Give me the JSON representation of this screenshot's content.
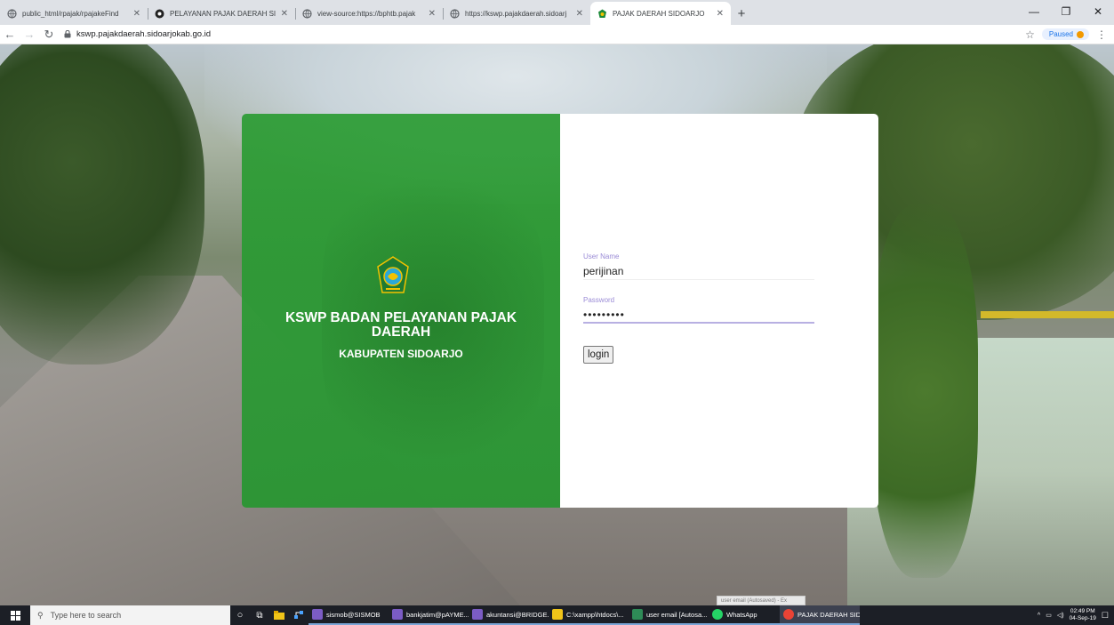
{
  "browser": {
    "tabs": [
      {
        "title": "public_html/rpajak/rpajakeFind",
        "icon": "globe-icon",
        "active": false
      },
      {
        "title": "PELAYANAN PAJAK DAERAH SID",
        "icon": "circle-logo-icon",
        "active": false
      },
      {
        "title": "view-source:https://bphtb.pajak",
        "icon": "globe-icon",
        "active": false
      },
      {
        "title": "https://kswp.pajakdaerah.sidoarj",
        "icon": "globe-icon",
        "active": false
      },
      {
        "title": "PAJAK DAERAH SIDOARJO",
        "icon": "emblem-icon",
        "active": true
      }
    ],
    "url": "kswp.pajakdaerah.sidoarjokab.go.id",
    "paused_label": "Paused"
  },
  "login_panel": {
    "title": "KSWP BADAN PELAYANAN PAJAK DAERAH",
    "subtitle": "KABUPATEN SIDOARJO",
    "username_label": "User Name",
    "username_value": "perijinan",
    "password_label": "Password",
    "password_value": "•••••••••",
    "login_label": "login"
  },
  "status_popup": "user email (Autosaved) - Ex",
  "taskbar": {
    "search_placeholder": "Type here to search",
    "apps": [
      {
        "label": "sismob@SISMOB",
        "color": "#7b5cc4",
        "active": false
      },
      {
        "label": "bankjatim@pAYME...",
        "color": "#7b5cc4",
        "active": false
      },
      {
        "label": "akuntansi@BRIDGE...",
        "color": "#7b5cc4",
        "active": false
      },
      {
        "label": "C:\\xampp\\htdocs\\...",
        "color": "#f0c419",
        "active": false
      },
      {
        "label": "user email [Autosa...",
        "color": "#2e8b57",
        "active": false
      },
      {
        "label": "WhatsApp",
        "color": "#25d366",
        "active": false
      },
      {
        "label": "PAJAK DAERAH SID...",
        "color": "#ea4335",
        "active": true
      }
    ],
    "time": "02:49 PM",
    "date": "04-Sep-19"
  },
  "colors": {
    "panel_green": "#2c9c34",
    "label_purple": "#9a8bd6",
    "taskbar": "#1c1f26"
  }
}
